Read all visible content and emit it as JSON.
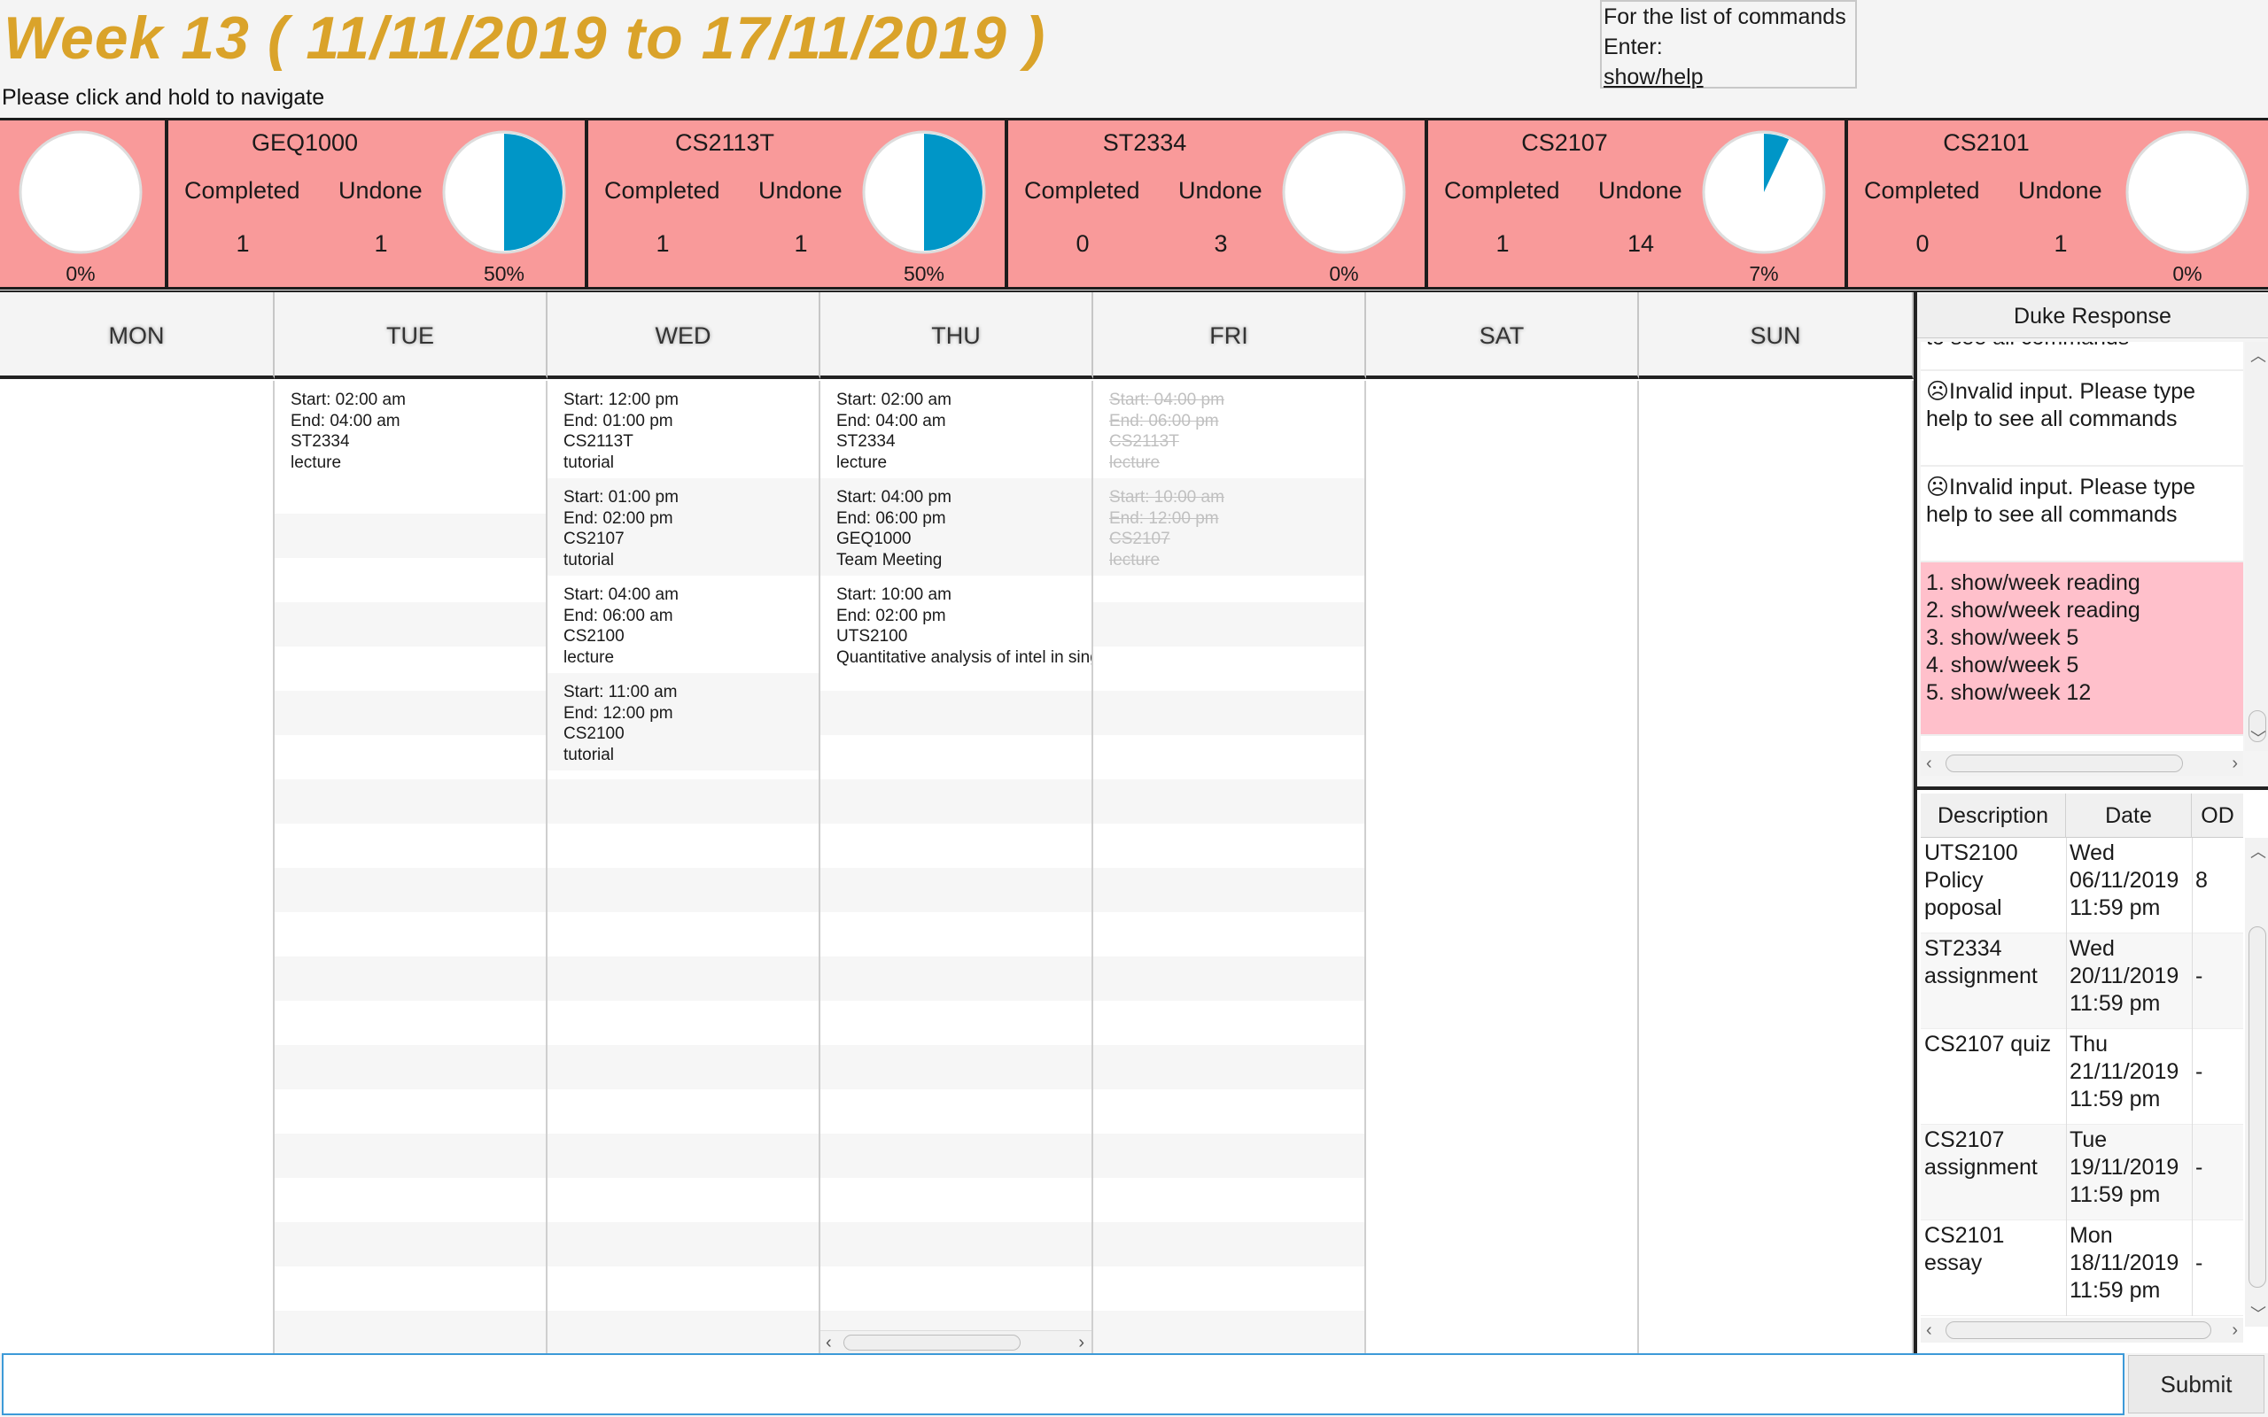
{
  "header": {
    "title": "Week 13 ( 11/11/2019 to 17/11/2019 )",
    "hint": "Please click and hold to navigate",
    "help_line1": "For the list of commands",
    "help_line2": "Enter:",
    "help_link": "show/help"
  },
  "modules": [
    {
      "name": "",
      "completed_label": "",
      "undone_label": "",
      "completed": "",
      "undone": "",
      "percent": "0%",
      "fraction": 0
    },
    {
      "name": "GEQ1000",
      "completed_label": "Completed",
      "undone_label": "Undone",
      "completed": "1",
      "undone": "1",
      "percent": "50%",
      "fraction": 0.5
    },
    {
      "name": "CS2113T",
      "completed_label": "Completed",
      "undone_label": "Undone",
      "completed": "1",
      "undone": "1",
      "percent": "50%",
      "fraction": 0.5
    },
    {
      "name": "ST2334",
      "completed_label": "Completed",
      "undone_label": "Undone",
      "completed": "0",
      "undone": "3",
      "percent": "0%",
      "fraction": 0
    },
    {
      "name": "CS2107",
      "completed_label": "Completed",
      "undone_label": "Undone",
      "completed": "1",
      "undone": "14",
      "percent": "7%",
      "fraction": 0.07
    },
    {
      "name": "CS2101",
      "completed_label": "Completed",
      "undone_label": "Undone",
      "completed": "0",
      "undone": "1",
      "percent": "0%",
      "fraction": 0
    }
  ],
  "colors": {
    "module_bg": "#f99a9a",
    "pie_fill": "#0096c7",
    "title": "#daa32a",
    "response_highlight": "#ffc0cb"
  },
  "days": [
    {
      "label": "MON",
      "tasks": []
    },
    {
      "label": "TUE",
      "tasks": [
        {
          "start": "Start: 02:00 am",
          "end": "End: 04:00 am",
          "module": "ST2334",
          "type": "lecture",
          "done": false
        }
      ]
    },
    {
      "label": "WED",
      "tasks": [
        {
          "start": "Start: 12:00 pm",
          "end": "End: 01:00 pm",
          "module": "CS2113T",
          "type": "tutorial",
          "done": false
        },
        {
          "start": "Start: 01:00 pm",
          "end": "End: 02:00 pm",
          "module": "CS2107",
          "type": "tutorial",
          "done": false
        },
        {
          "start": "Start: 04:00 am",
          "end": "End: 06:00 am",
          "module": "CS2100",
          "type": "lecture",
          "done": false
        },
        {
          "start": "Start: 11:00 am",
          "end": "End: 12:00 pm",
          "module": "CS2100",
          "type": "tutorial",
          "done": false
        }
      ]
    },
    {
      "label": "THU",
      "tasks": [
        {
          "start": "Start: 02:00 am",
          "end": "End: 04:00 am",
          "module": "ST2334",
          "type": "lecture",
          "done": false
        },
        {
          "start": "Start: 04:00 pm",
          "end": "End: 06:00 pm",
          "module": "GEQ1000",
          "type": "Team Meeting",
          "done": false
        },
        {
          "start": "Start: 10:00 am",
          "end": "End: 02:00 pm",
          "module": "UTS2100",
          "type": "Quantitative analysis of intel in sing",
          "done": false
        }
      ]
    },
    {
      "label": "FRI",
      "tasks": [
        {
          "start": "Start: 04:00 pm",
          "end": "End: 06:00 pm",
          "module": "CS2113T",
          "type": "lecture",
          "done": true
        },
        {
          "start": "Start: 10:00 am",
          "end": "End: 12:00 pm",
          "module": "CS2107",
          "type": "lecture",
          "done": true
        }
      ]
    },
    {
      "label": "SAT",
      "tasks": []
    },
    {
      "label": "SUN",
      "tasks": []
    }
  ],
  "duke": {
    "title": "Duke Response",
    "responses": [
      {
        "text": "to see all commands",
        "highlight": false
      },
      {
        "text": "☹Invalid input. Please type help to see all commands",
        "highlight": false
      },
      {
        "text": "☹Invalid input. Please type help to see all commands",
        "highlight": false
      },
      {
        "text": "1. show/week reading\n2. show/week reading\n3. show/week 5\n4. show/week 5\n5. show/week 12",
        "highlight": true
      }
    ]
  },
  "deadlines": {
    "headers": [
      "Description",
      "Date",
      "OD"
    ],
    "rows": [
      {
        "desc": "UTS2100 Policy poposal",
        "date": "Wed 06/11/2019 11:59 pm",
        "od": "8"
      },
      {
        "desc": "ST2334 assignment",
        "date": "Wed 20/11/2019 11:59 pm",
        "od": "-"
      },
      {
        "desc": "CS2107 quiz",
        "date": "Thu 21/11/2019 11:59 pm",
        "od": "-"
      },
      {
        "desc": "CS2107 assignment",
        "date": "Tue 19/11/2019 11:59 pm",
        "od": "-"
      },
      {
        "desc": "CS2101 essay",
        "date": "Mon 18/11/2019 11:59 pm",
        "od": "-"
      }
    ]
  },
  "input": {
    "value": "",
    "placeholder": ""
  },
  "submit_label": "Submit"
}
